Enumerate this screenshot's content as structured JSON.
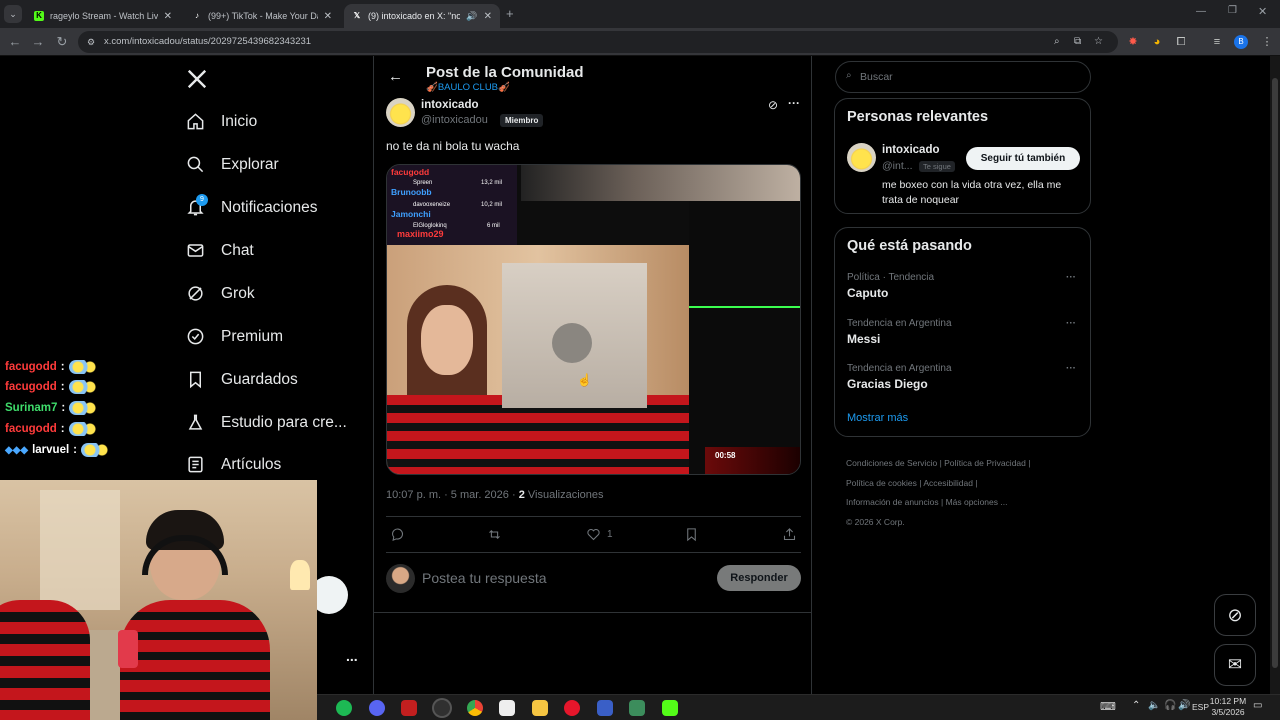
{
  "browser": {
    "tabs": [
      {
        "label": "rageylo Stream - Watch Live on",
        "icon": "kick-icon",
        "active": false
      },
      {
        "label": "(99+) TikTok - Make Your Day",
        "icon": "tiktok-icon",
        "active": false
      },
      {
        "label": "(9) intoxicado en X: \"no te d",
        "icon": "x-icon",
        "active": true
      }
    ],
    "url": "x.com/intoxicadou/status/2029725439682343231",
    "profile_initial": "B"
  },
  "nav": {
    "items": [
      {
        "label": "Inicio",
        "icon": "home-icon"
      },
      {
        "label": "Explorar",
        "icon": "search-icon"
      },
      {
        "label": "Notificaciones",
        "icon": "bell-icon",
        "badge": "9"
      },
      {
        "label": "Chat",
        "icon": "mail-icon"
      },
      {
        "label": "Grok",
        "icon": "grok-icon"
      },
      {
        "label": "Premium",
        "icon": "verified-icon"
      },
      {
        "label": "Guardados",
        "icon": "bookmark-icon"
      },
      {
        "label": "Estudio para cre...",
        "icon": "flask-icon"
      },
      {
        "label": "Artículos",
        "icon": "article-icon"
      }
    ],
    "more": "..."
  },
  "stream_chat": [
    {
      "user": "facugodd",
      "color": "#ff3b3b"
    },
    {
      "user": "facugodd",
      "color": "#ff3b3b"
    },
    {
      "user": "Surinam7",
      "color": "#3fdc6b"
    },
    {
      "user": "facugodd",
      "color": "#ff3b3b"
    },
    {
      "user": "larvuel",
      "color": "#ffffff"
    }
  ],
  "post": {
    "header_title": "Post de la Comunidad",
    "community": "🎻BAULO CLUB🎻",
    "author_name": "intoxicado",
    "author_handle": "@intoxicadou",
    "member_badge": "Miembro",
    "text": "no te da ni bola tu wacha",
    "media": {
      "leaderboard": [
        {
          "name": "facugodd",
          "count": ""
        },
        {
          "name": "Spreen",
          "count": "13,2 mil"
        },
        {
          "name": "Brunoobb",
          "count": ""
        },
        {
          "name": "davooxeneize",
          "count": "10,2 mil"
        },
        {
          "name": "Jamonchi",
          "count": ""
        },
        {
          "name": "ElGloglokinq",
          "count": "6 mil"
        },
        {
          "name": "maxiimo29",
          "count": ""
        }
      ],
      "timer": "00:58"
    },
    "time": "10:07 p. m. · 5 mar. 2026 ·",
    "views_count": "2",
    "views_label": "Visualizaciones",
    "likes": "1",
    "reply_placeholder": "Postea tu respuesta",
    "reply_button": "Responder"
  },
  "sidebar": {
    "search_placeholder": "Buscar",
    "relevant_title": "Personas relevantes",
    "relevant_name": "intoxicado",
    "relevant_handle": "@int...",
    "follows_you": "Te sigue",
    "follow_back": "Seguir tú también",
    "bio": "me boxeo con la vida otra vez, ella me trata de noquear",
    "trends_title": "Qué está pasando",
    "trends": [
      {
        "category": "Política · Tendencia",
        "name": "Caputo"
      },
      {
        "category": "Tendencia en Argentina",
        "name": "Messi"
      },
      {
        "category": "Tendencia en Argentina",
        "name": "Gracias Diego"
      }
    ],
    "show_more": "Mostrar más",
    "footer": {
      "terms": "Condiciones de Servicio",
      "privacy": "Política de Privacidad",
      "cookies": "Política de cookies",
      "accessibility": "Accesibilidad",
      "ads": "Información de anuncios",
      "more": "Más opciones ...",
      "copyright": "© 2026 X Corp."
    }
  },
  "taskbar": {
    "lang": "ESP",
    "time": "10:12 PM",
    "date": "3/5/2026"
  },
  "colors": {
    "accent": "#1d9bf0",
    "background": "#000000",
    "border": "#2f3336",
    "muted": "#71767b"
  }
}
